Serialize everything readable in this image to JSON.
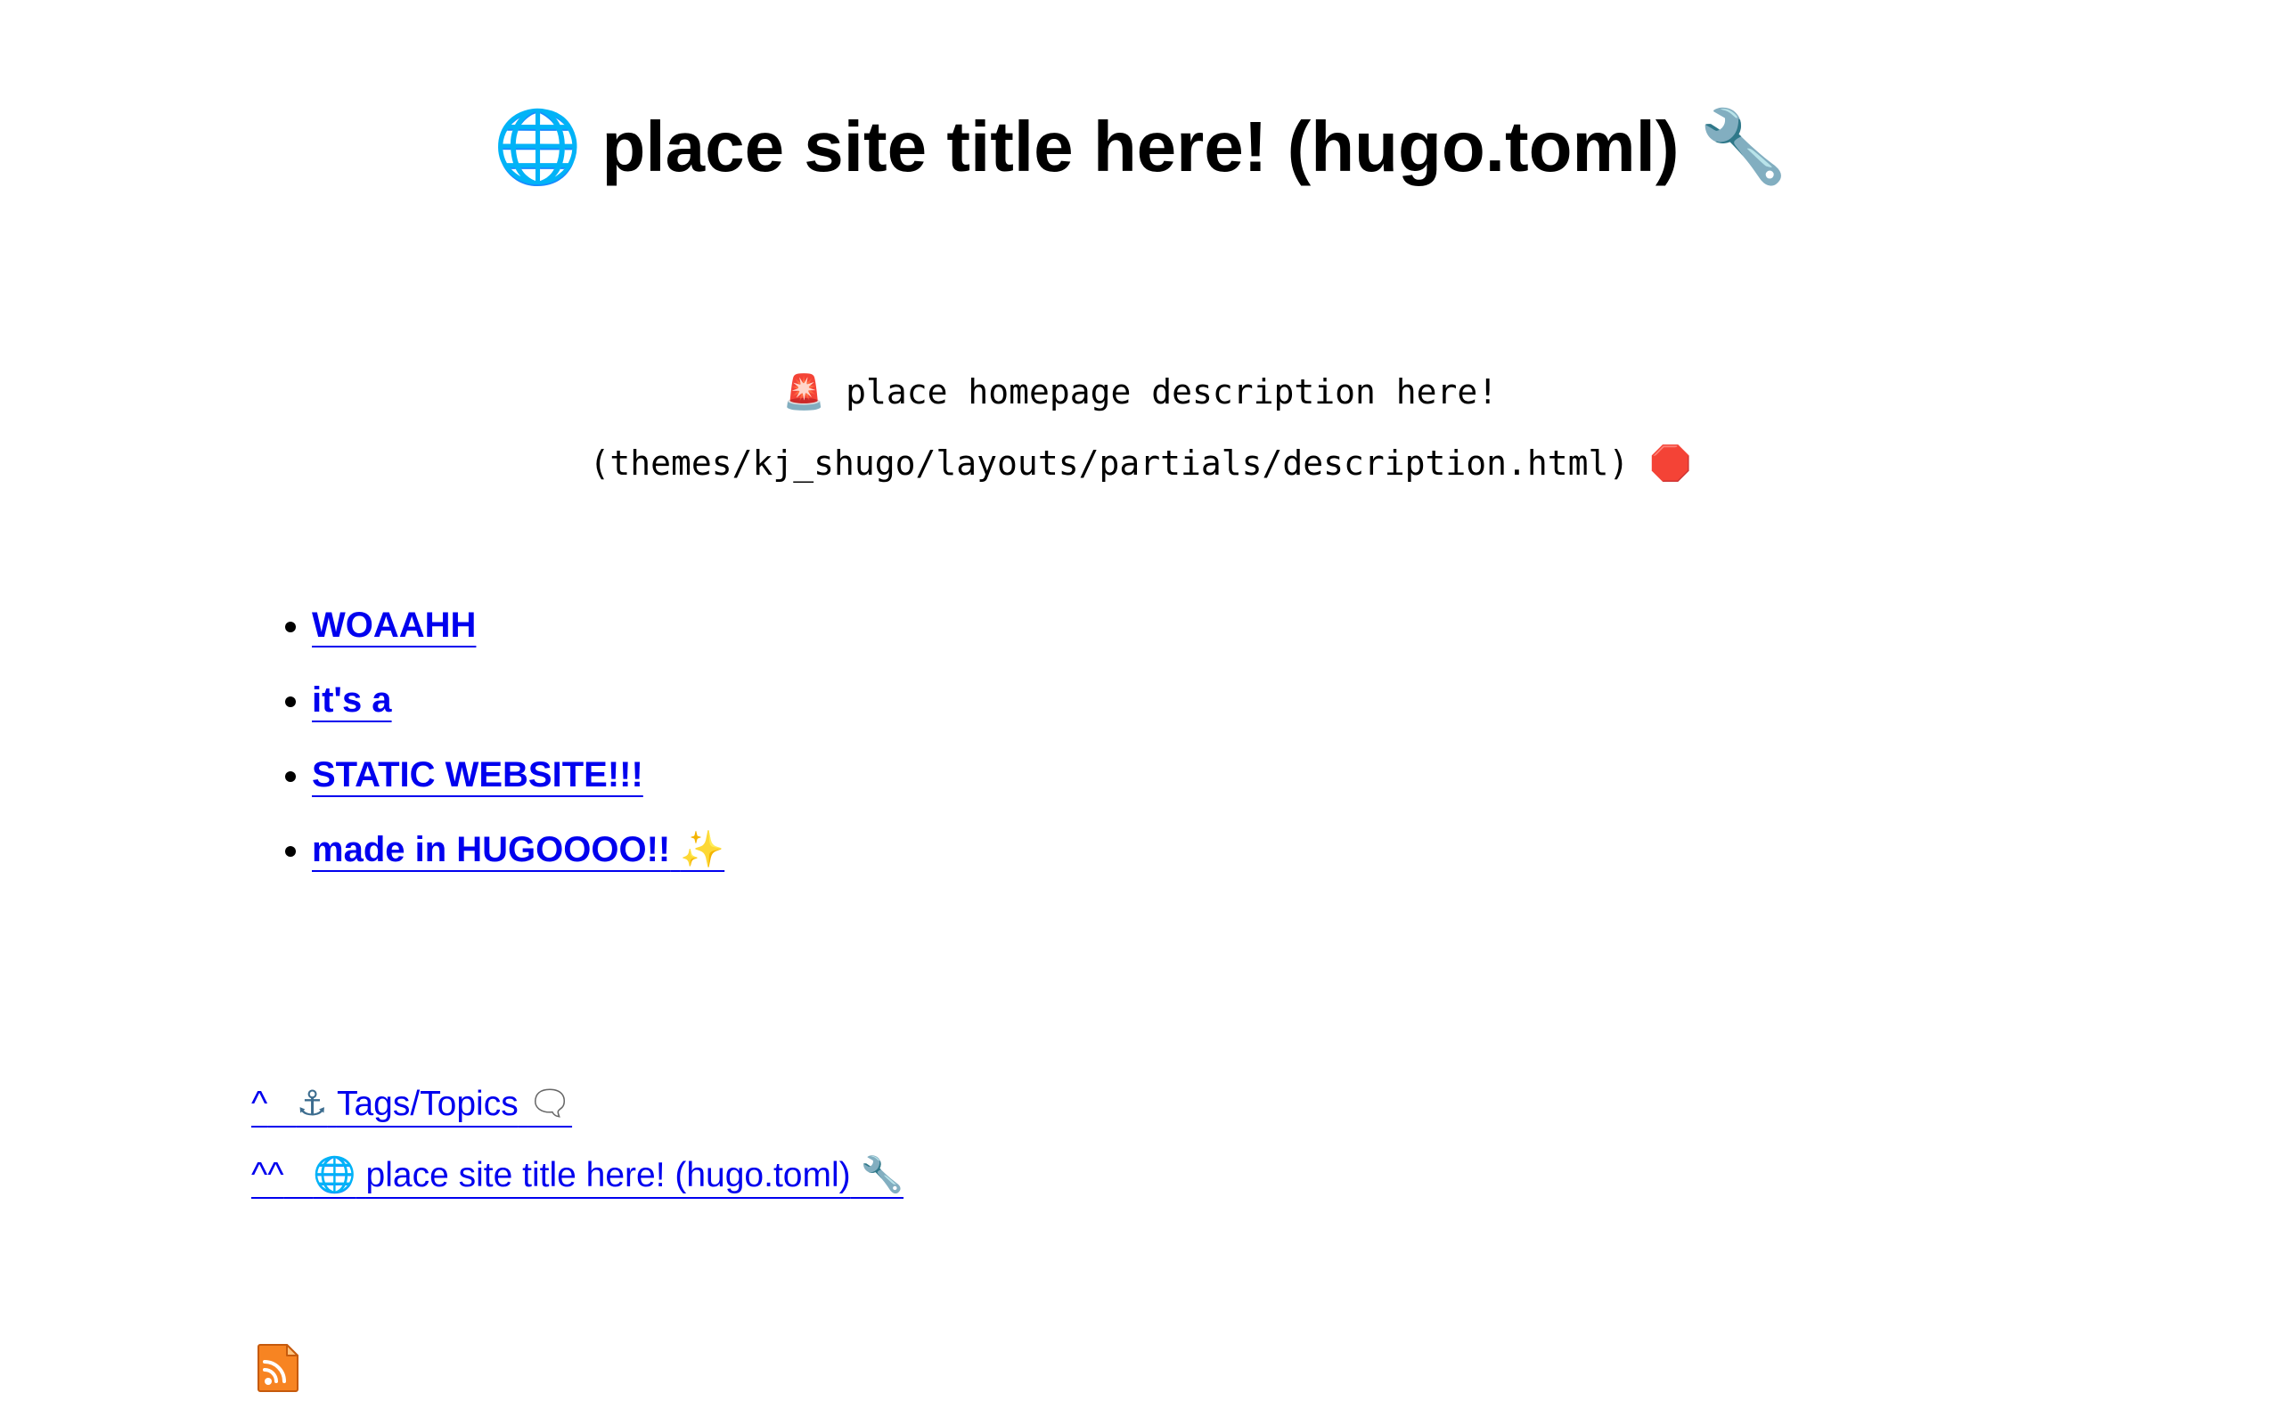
{
  "header": {
    "globe_icon": "🌐",
    "title": "place site title here! (hugo.toml)",
    "wrench_icon": "🔧"
  },
  "description": {
    "siren_icon": "🚨",
    "text": "place homepage description here! (themes/kj_shugo/layouts/partials/description.html)",
    "stop_icon": "🛑"
  },
  "nav": {
    "items": [
      {
        "label": "WOAAHH"
      },
      {
        "label": "it's a"
      },
      {
        "label": "STATIC WEBSITE!!!"
      },
      {
        "label": "made in HUGOOOO!!",
        "icon": "✨"
      }
    ]
  },
  "footer": {
    "links": [
      {
        "prefix": "^",
        "anchor_icon": "⚓",
        "label": "Tags/Topics",
        "speech_icon": "🗨"
      },
      {
        "prefix": "^^",
        "globe_icon": "🌐",
        "label": "place site title here! (hugo.toml)",
        "wrench_icon": "🔧"
      }
    ],
    "rss_icon": "rss-feed-icon",
    "rss_color": "#f78422"
  }
}
